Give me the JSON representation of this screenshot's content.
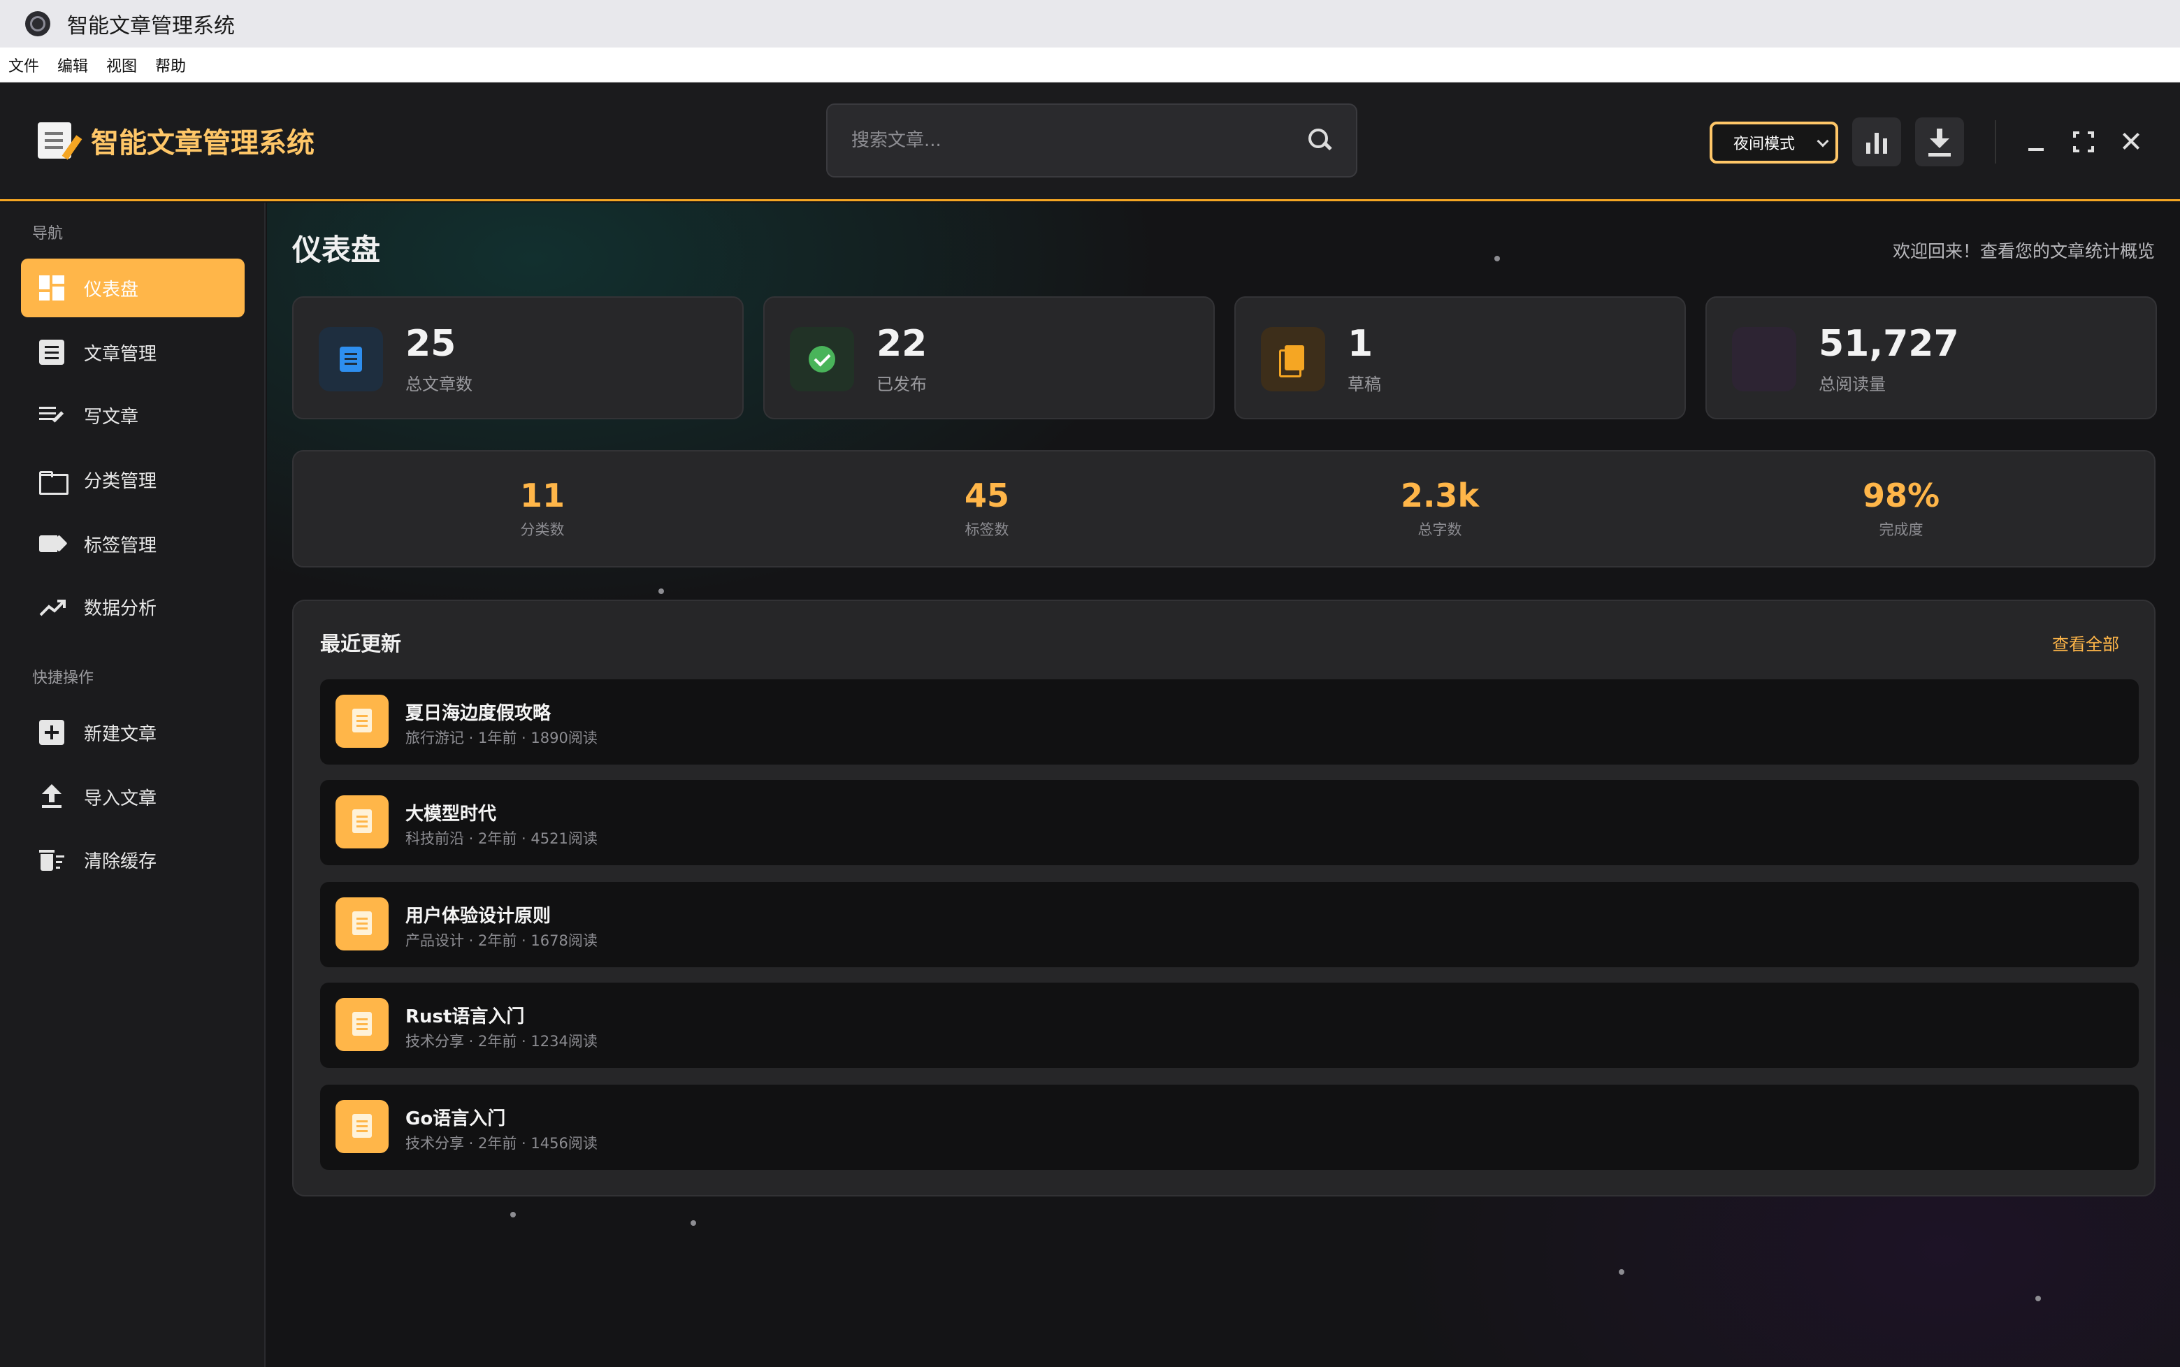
{
  "window": {
    "title": "智能文章管理系统"
  },
  "menubar": {
    "items": [
      "文件",
      "编辑",
      "视图",
      "帮助"
    ]
  },
  "header": {
    "brand": "智能文章管理系统",
    "search_placeholder": "搜索文章...",
    "theme_mode": "夜间模式"
  },
  "sidebar": {
    "nav_heading": "导航",
    "nav_items": [
      {
        "label": "仪表盘",
        "icon": "dashboard-icon",
        "active": true
      },
      {
        "label": "文章管理",
        "icon": "document-icon"
      },
      {
        "label": "写文章",
        "icon": "edit-note-icon"
      },
      {
        "label": "分类管理",
        "icon": "folder-icon"
      },
      {
        "label": "标签管理",
        "icon": "tag-icon"
      },
      {
        "label": "数据分析",
        "icon": "trending-up-icon"
      }
    ],
    "quick_heading": "快捷操作",
    "quick_items": [
      {
        "label": "新建文章",
        "icon": "add-box-icon"
      },
      {
        "label": "导入文章",
        "icon": "upload-icon"
      },
      {
        "label": "清除缓存",
        "icon": "delete-sweep-icon"
      }
    ]
  },
  "main": {
    "title": "仪表盘",
    "subtitle": "欢迎回来！查看您的文章统计概览",
    "stats": [
      {
        "value": "25",
        "label": "总文章数",
        "icon": "article-icon",
        "color": "#2e8ff0"
      },
      {
        "value": "22",
        "label": "已发布",
        "icon": "check-circle-icon",
        "color": "#49b45a"
      },
      {
        "value": "1",
        "label": "草稿",
        "icon": "file-copy-icon",
        "color": "#f5a623"
      },
      {
        "value": "51,727",
        "label": "总阅读量",
        "icon": "views-icon",
        "color": "#2d2433"
      }
    ],
    "mini_stats": [
      {
        "value": "11",
        "label": "分类数"
      },
      {
        "value": "45",
        "label": "标签数"
      },
      {
        "value": "2.3k",
        "label": "总字数"
      },
      {
        "value": "98%",
        "label": "完成度"
      }
    ],
    "recent": {
      "title": "最近更新",
      "view_all": "查看全部",
      "articles": [
        {
          "title": "夏日海边度假攻略",
          "meta": "旅行游记 · 1年前 · 1890阅读"
        },
        {
          "title": "大模型时代",
          "meta": "科技前沿 · 2年前 · 4521阅读"
        },
        {
          "title": "用户体验设计原则",
          "meta": "产品设计 · 2年前 · 1678阅读"
        },
        {
          "title": "Rust语言入门",
          "meta": "技术分享 · 2年前 · 1234阅读"
        },
        {
          "title": "Go语言入门",
          "meta": "技术分享 · 2年前 · 1456阅读"
        }
      ]
    }
  },
  "colors": {
    "accent": "#ffb649",
    "brand_text": "#ffc768",
    "header_border": "#f5a623"
  }
}
